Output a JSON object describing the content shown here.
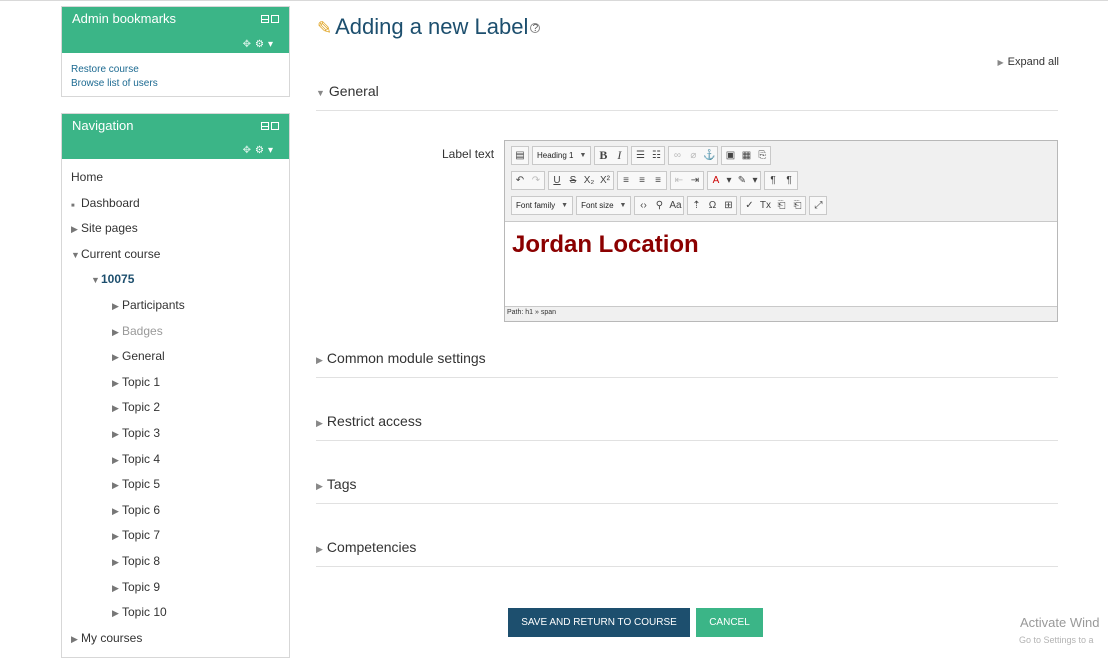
{
  "admin_bookmarks": {
    "title": "Admin bookmarks",
    "links": [
      "Restore course",
      "Browse list of users"
    ]
  },
  "navigation": {
    "title": "Navigation",
    "items": [
      {
        "label": "Home",
        "indent": 0,
        "marker": ""
      },
      {
        "label": "Dashboard",
        "indent": 0,
        "marker": "■"
      },
      {
        "label": "Site pages",
        "indent": 0,
        "marker": "▶"
      },
      {
        "label": "Current course",
        "indent": 0,
        "marker": "▼"
      },
      {
        "label": "10075",
        "indent": 1,
        "marker": "▼"
      },
      {
        "label": "Participants",
        "indent": 2,
        "marker": "▶"
      },
      {
        "label": "Badges",
        "indent": 2,
        "marker": "▶"
      },
      {
        "label": "General",
        "indent": 2,
        "marker": "▶"
      },
      {
        "label": "Topic 1",
        "indent": 2,
        "marker": "▶"
      },
      {
        "label": "Topic 2",
        "indent": 2,
        "marker": "▶"
      },
      {
        "label": "Topic 3",
        "indent": 2,
        "marker": "▶"
      },
      {
        "label": "Topic 4",
        "indent": 2,
        "marker": "▶"
      },
      {
        "label": "Topic 5",
        "indent": 2,
        "marker": "▶"
      },
      {
        "label": "Topic 6",
        "indent": 2,
        "marker": "▶"
      },
      {
        "label": "Topic 7",
        "indent": 2,
        "marker": "▶"
      },
      {
        "label": "Topic 8",
        "indent": 2,
        "marker": "▶"
      },
      {
        "label": "Topic 9",
        "indent": 2,
        "marker": "▶"
      },
      {
        "label": "Topic 10",
        "indent": 2,
        "marker": "▶"
      },
      {
        "label": "My courses",
        "indent": 0,
        "marker": "▶"
      }
    ]
  },
  "page": {
    "title": "Adding a new Label",
    "expand_all": "Expand all"
  },
  "sections": {
    "general": "General",
    "common": "Common module settings",
    "restrict": "Restrict access",
    "tags": "Tags",
    "competencies": "Competencies"
  },
  "form": {
    "label_text": "Label text"
  },
  "editor": {
    "heading_select": "Heading 1",
    "font_family": "Font family",
    "font_size": "Font size",
    "content": "Jordan Location",
    "path": "Path: h1 » span"
  },
  "buttons": {
    "save": "SAVE AND RETURN TO COURSE",
    "cancel": "CANCEL"
  },
  "watermark": {
    "title": "Activate Wind",
    "subtitle": "Go to Settings to a"
  },
  "colors": {
    "brand_green": "#3bb587",
    "primary_navy": "#1d4f6e",
    "heading_red": "#8b0000"
  }
}
